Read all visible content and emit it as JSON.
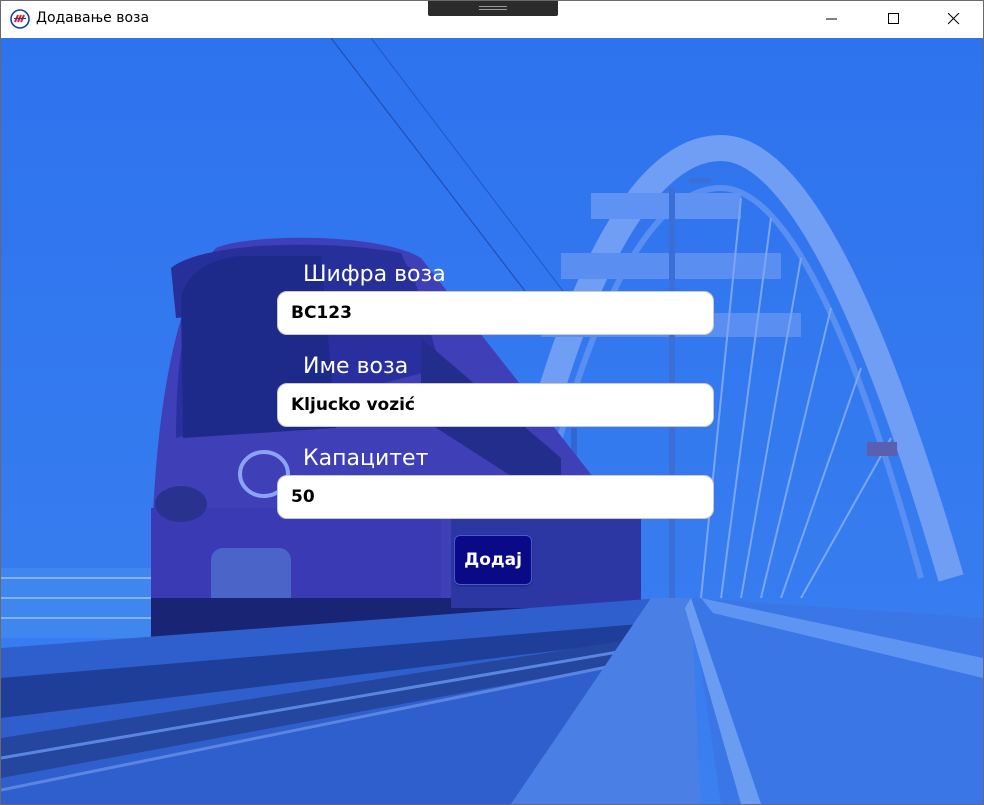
{
  "window": {
    "title": "Додавање воза",
    "icon": "railway-logo-icon",
    "controls": [
      "minimize-icon",
      "maximize-icon",
      "close-icon"
    ]
  },
  "form": {
    "code_label": "Шифра воза",
    "code_value": "BC123",
    "name_label": "Име воза",
    "name_value": "Kljucko vozić",
    "capacity_label": "Капацитет",
    "capacity_value": "50",
    "submit_label": "Додај"
  },
  "colors": {
    "background_tint": "#2a6fe8",
    "button": "#0a0a86",
    "label_text": "#ffffff"
  }
}
